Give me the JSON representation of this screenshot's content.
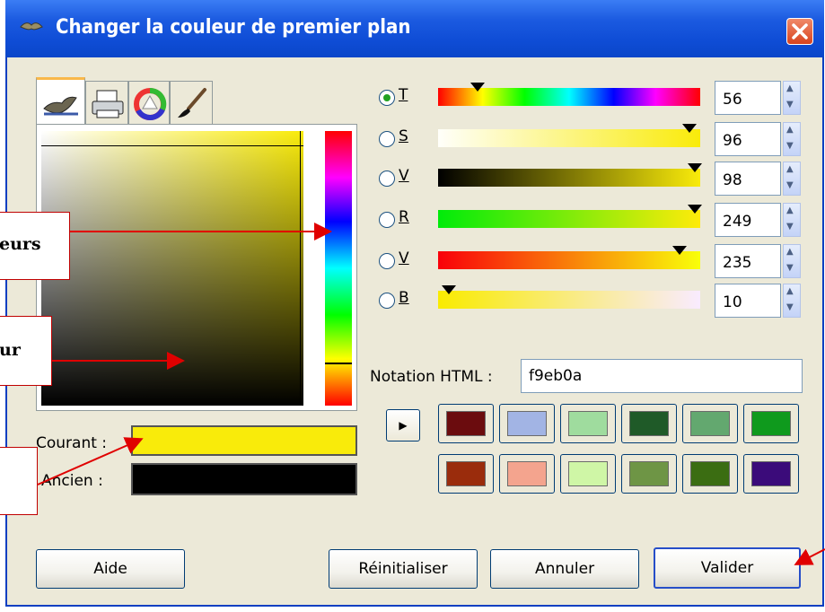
{
  "window": {
    "title": "Changer la couleur de premier plan"
  },
  "tabs": [
    {
      "icon": "wilber-icon"
    },
    {
      "icon": "printer-icon"
    },
    {
      "icon": "color-wheel-icon"
    },
    {
      "icon": "paintbrush-icon"
    }
  ],
  "colors": {
    "current": "#f9eb0a",
    "old": "#000000"
  },
  "labels": {
    "courant": "Courant :",
    "ancien": "Ancien :",
    "html_notation": "Notation HTML :"
  },
  "html_value": "f9eb0a",
  "channels": [
    {
      "label": "T",
      "value": "56",
      "selected": true
    },
    {
      "label": "S",
      "value": "96",
      "selected": false
    },
    {
      "label": "V",
      "value": "98",
      "selected": false
    },
    {
      "label": "R",
      "value": "249",
      "selected": false
    },
    {
      "label": "V",
      "value": "235",
      "selected": false
    },
    {
      "label": "B",
      "value": "10",
      "selected": false
    }
  ],
  "history": [
    "#6b0c0e",
    "#a2b4e4",
    "#9fdc9e",
    "#1f5a28",
    "#63a86f",
    "#0f9a1d",
    "#9a2c0c",
    "#f4a48e",
    "#cff6a6",
    "#6e9545",
    "#3b6d12",
    "#3b0b7a"
  ],
  "buttons": {
    "aide": "Aide",
    "reinit": "Réinitialiser",
    "annuler": "Annuler",
    "valider": "Valider"
  },
  "annotations": {
    "a1": "eurs",
    "a2": "ur"
  }
}
